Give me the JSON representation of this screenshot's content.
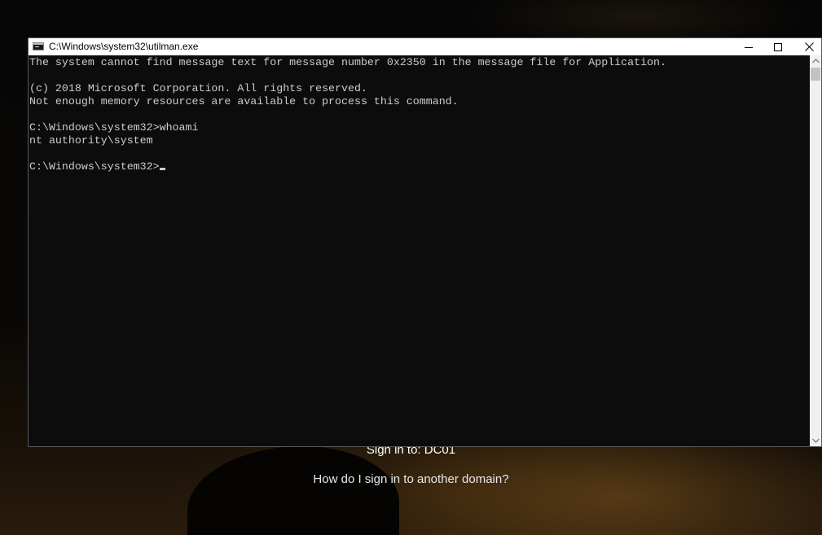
{
  "window": {
    "title": "C:\\Windows\\system32\\utilman.exe",
    "icon": "cmd-icon",
    "buttons": {
      "minimize_icon": "minimize-icon",
      "maximize_icon": "maximize-icon",
      "close_icon": "close-icon"
    }
  },
  "console": {
    "lines": [
      "The system cannot find message text for message number 0x2350 in the message file for Application.",
      "",
      "(c) 2018 Microsoft Corporation. All rights reserved.",
      "Not enough memory resources are available to process this command.",
      "",
      "C:\\Windows\\system32>whoami",
      "nt authority\\system",
      "",
      "C:\\Windows\\system32>"
    ],
    "text_color": "#cccccc",
    "background_color": "#0c0c0c"
  },
  "lockscreen": {
    "sign_in_to": "Sign in to: DC01",
    "other_domain_link": "How do I sign in to another domain?"
  }
}
